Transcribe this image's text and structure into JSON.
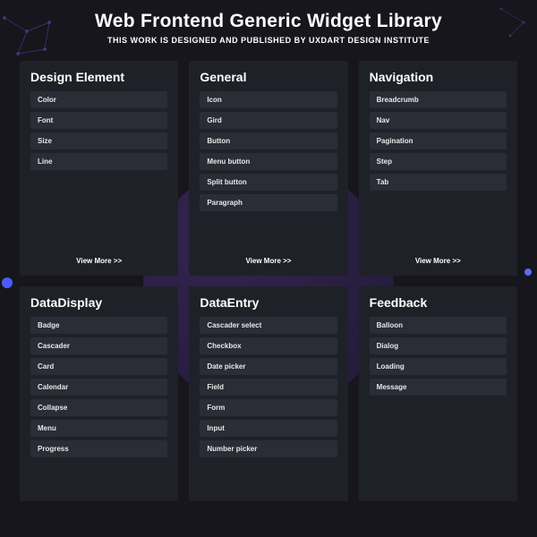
{
  "header": {
    "title": "Web Frontend Generic Widget Library",
    "subtitle": "THIS WORK IS DESIGNED AND PUBLISHED BY UXDART DESIGN INSTITUTE"
  },
  "view_more_label": "View More >>",
  "categories": [
    {
      "title": "Design Element",
      "items": [
        "Color",
        "Font",
        "Size",
        "Line"
      ],
      "show_more": true
    },
    {
      "title": "General",
      "items": [
        "Icon",
        "Gird",
        "Button",
        "Menu button",
        "Split button",
        "Paragraph"
      ],
      "show_more": true
    },
    {
      "title": "Navigation",
      "items": [
        "Breadcrumb",
        "Nav",
        "Pagination",
        "Step",
        "Tab"
      ],
      "show_more": true
    },
    {
      "title": "DataDisplay",
      "items": [
        "Badge",
        "Cascader",
        "Card",
        "Calendar",
        "Collapse",
        "Menu",
        "Progress"
      ],
      "show_more": false
    },
    {
      "title": "DataEntry",
      "items": [
        "Cascader select",
        "Checkbox",
        "Date picker",
        "Field",
        "Form",
        "Input",
        "Number picker"
      ],
      "show_more": false
    },
    {
      "title": "Feedback",
      "items": [
        "Balloon",
        "Dialog",
        "Loading",
        "Message"
      ],
      "show_more": false
    }
  ]
}
